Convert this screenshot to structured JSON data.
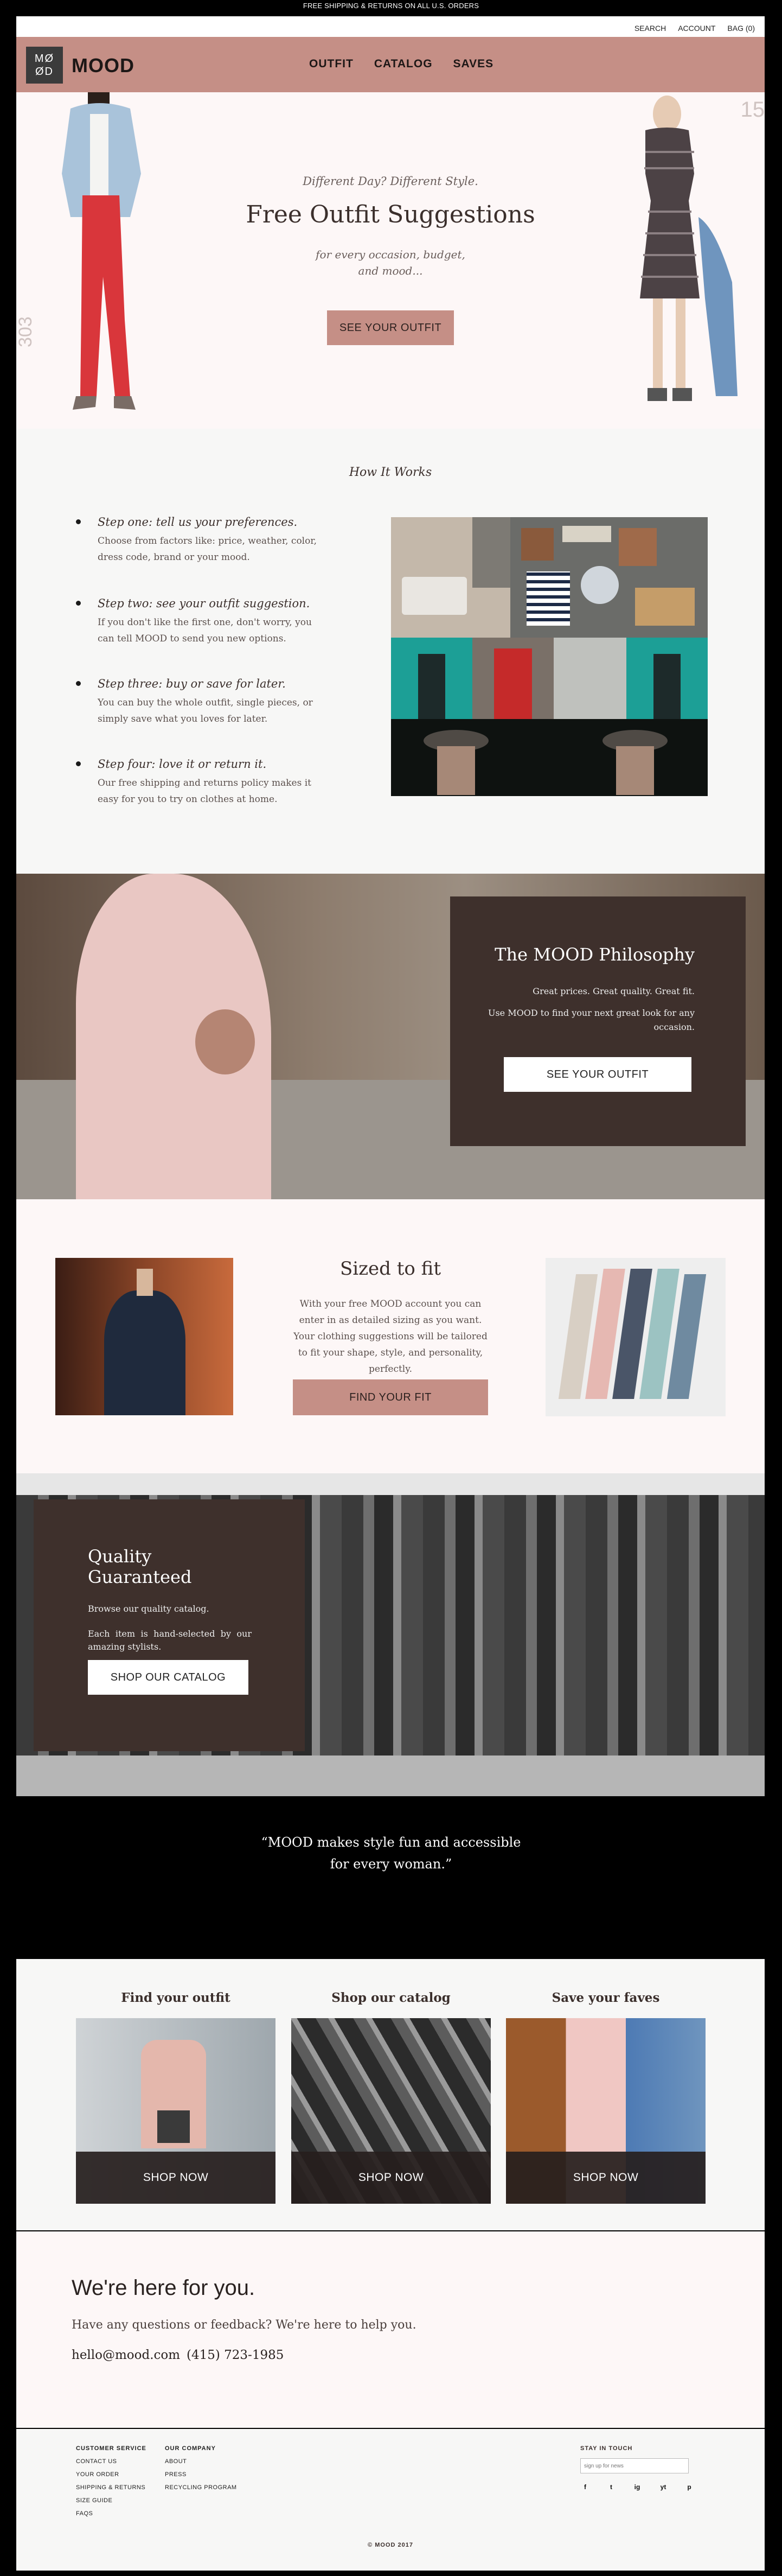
{
  "promo": "FREE SHIPPING & RETURNS ON ALL U.S. ORDERS",
  "util": {
    "search": "SEARCH",
    "account": "ACCOUNT",
    "bag": "BAG (0)"
  },
  "header": {
    "logo_line1": "MØ",
    "logo_line2": "ØD",
    "brand": "MOOD",
    "nav": [
      "OUTFIT",
      "CATALOG",
      "SAVES"
    ]
  },
  "hero": {
    "tagline": "Different Day? Different Style.",
    "title": "Free Outfit Suggestions",
    "subtitle_line1": "for every occasion, budget,",
    "subtitle_line2": "and mood...",
    "button": "SEE YOUR OUTFIT",
    "deco_num_right": "15",
    "deco_num_left": "303"
  },
  "how": {
    "title": "How It Works",
    "steps": [
      {
        "title": "Step one: tell us your preferences.",
        "body": "Choose from factors like: price, weather, color, dress code, brand or your mood."
      },
      {
        "title": "Step two: see your outfit suggestion.",
        "body": "If you don't like the first one, don't worry, you can tell MOOD to send you new options."
      },
      {
        "title": "Step three: buy or save for later.",
        "body": "You can buy the whole outfit, single pieces, or simply save what you loves for later."
      },
      {
        "title": "Step four: love it or return it.",
        "body": "Our free shipping and returns policy makes it easy for you to try on clothes at home."
      }
    ]
  },
  "philosophy": {
    "title": "The MOOD Philosophy",
    "line1": "Great prices. Great quality. Great fit.",
    "line2": "Use MOOD to find your next great look for any occasion.",
    "button": "SEE YOUR OUTFIT"
  },
  "sized": {
    "title": "Sized to fit",
    "body": "With your free MOOD account you can enter in as detailed sizing as you want. Your clothing suggestions will be tailored to fit your shape, style, and personality, perfectly.",
    "button": "FIND YOUR FIT"
  },
  "quality": {
    "title": "Quality Guaranteed",
    "line1": "Browse our quality catalog.",
    "line2": "Each item is hand-selected by our amazing stylists.",
    "button": "SHOP OUR CATALOG"
  },
  "quote": {
    "line1": "“MOOD makes style fun and accessible",
    "line2": "for every woman.”"
  },
  "shop": {
    "cards": [
      {
        "title": "Find your outfit",
        "button": "SHOP NOW"
      },
      {
        "title": "Shop our catalog",
        "button": "SHOP NOW"
      },
      {
        "title": "Save your faves",
        "button": "SHOP NOW"
      }
    ]
  },
  "contact": {
    "title": "We're here for you.",
    "subtitle": "Have any questions or feedback? We're here to help you.",
    "email": "hello@mood.com",
    "phone": "(415) 723-1985"
  },
  "footer": {
    "col1_title": "CUSTOMER SERVICE",
    "col1": [
      "CONTACT US",
      "YOUR ORDER",
      "SHIPPING & RETURNS",
      "SIZE GUIDE",
      "FAQS"
    ],
    "col2_title": "OUR COMPANY",
    "col2": [
      "ABOUT",
      "PRESS",
      "RECYCLING PROGRAM"
    ],
    "stay_title": "STAY IN TOUCH",
    "email_placeholder": "sign up for news",
    "socials": [
      "f",
      "t",
      "ig",
      "yt",
      "p"
    ],
    "copyright": "© MOOD 2017"
  },
  "colors": {
    "accent": "#c58f86",
    "dark_card": "#3e302c",
    "hero_bg": "#fdf7f7"
  }
}
